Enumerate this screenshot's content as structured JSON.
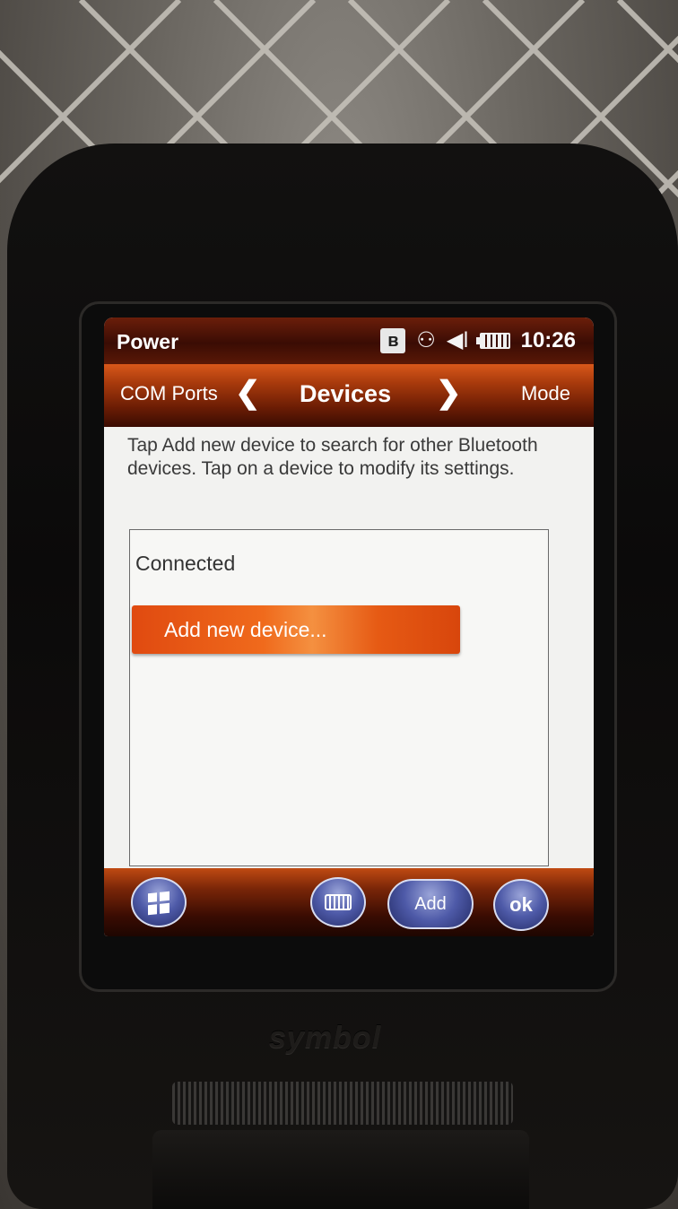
{
  "statusbar": {
    "app_title": "Power",
    "bluetooth_glyph": "ʙ",
    "clock": "10:26",
    "icons": [
      "bluetooth-icon",
      "connectivity-icon",
      "volume-icon",
      "battery-icon"
    ]
  },
  "tabs": {
    "previous": "COM Ports",
    "current": "Devices",
    "next": "Mode",
    "left_chevron": "❮",
    "right_chevron": "❯"
  },
  "instructions": "Tap Add new device to search for other Bluetooth devices. Tap on a device to modify its settings.",
  "device_list": {
    "section_label": "Connected",
    "add_item": "Add new device..."
  },
  "softkeys": {
    "add_label": "Add",
    "ok_label": "ok"
  },
  "hardware": {
    "brand": "symbol"
  },
  "colors": {
    "accent_orange": "#e65a14",
    "titlebar_dark_red": "#3a0c04",
    "softkey_blue": "#4e5aa8"
  }
}
